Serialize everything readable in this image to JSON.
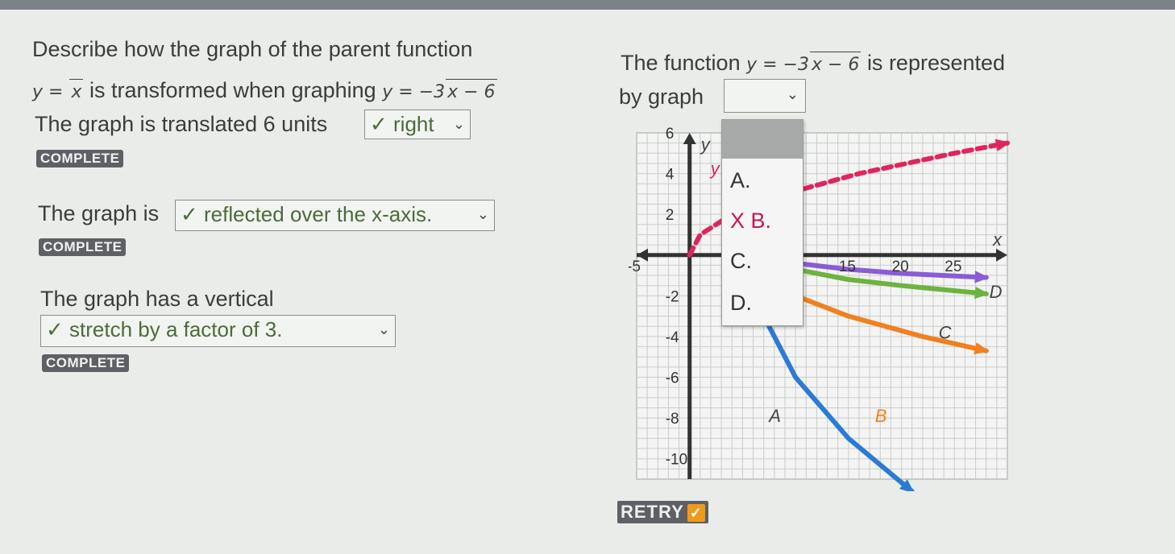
{
  "question": {
    "intro": "Describe how the graph of the parent function",
    "parent_fn": "y = √x",
    "parent_prefix": "y = ",
    "parent_radicand": "x",
    "transform_text": "is transformed when graphing",
    "target_prefix": "y = −3",
    "target_radicand": "x − 6",
    "target_fn": "y = −3√(x − 6)"
  },
  "part1": {
    "text": "The graph is translated 6 units",
    "answer": "✓ right",
    "status": "COMPLETE"
  },
  "part2": {
    "text": "The graph is",
    "answer": "✓ reflected over the x-axis.",
    "status": "COMPLETE"
  },
  "part3": {
    "text": "The graph has a vertical",
    "answer": "✓ stretch by a factor of 3.",
    "status": "COMPLETE"
  },
  "right_question": {
    "line1_prefix": "The function",
    "fn_prefix": "y = −3",
    "fn_radicand": "x − 6",
    "line1_suffix": "is represented",
    "line2": "by graph"
  },
  "dropdown": {
    "options": [
      "A.",
      "X B.",
      "C.",
      "D."
    ],
    "incorrect_option_color": "#c2185b"
  },
  "graph": {
    "x_axis_label": "x",
    "y_axis_label": "y",
    "x_ticks": [
      "-5",
      "15",
      "20",
      "25"
    ],
    "y_ticks": [
      "6",
      "4",
      "2",
      "-2",
      "-4",
      "-6",
      "-8",
      "-10"
    ],
    "curve_labels": {
      "A": "A",
      "B": "B",
      "C": "C",
      "D": "D",
      "y": "y"
    },
    "colors": {
      "y": "#e0245e",
      "A": "#2b7bd6",
      "B": "#f08020",
      "C": "#6db33f",
      "D": "#8a5cd6"
    }
  },
  "retry": {
    "label": "RETRY",
    "check": "✓"
  },
  "chart_data": {
    "type": "line",
    "title": "",
    "xlabel": "x",
    "ylabel": "y",
    "xlim": [
      -5,
      30
    ],
    "ylim": [
      -10,
      6
    ],
    "series": [
      {
        "name": "y",
        "style": "dashed",
        "x": [
          0,
          1,
          4,
          9,
          16,
          25,
          30
        ],
        "y": [
          0,
          1,
          2,
          3,
          4,
          5,
          5.5
        ]
      },
      {
        "name": "A",
        "x": [
          6,
          7,
          10,
          15,
          21
        ],
        "y": [
          0,
          -3,
          -6,
          -9,
          -11.6
        ]
      },
      {
        "name": "B",
        "x": [
          6,
          7,
          10,
          15,
          22,
          28
        ],
        "y": [
          0,
          -1,
          -2,
          -3,
          -4,
          -4.7
        ]
      },
      {
        "name": "C",
        "x": [
          6,
          10,
          15,
          20,
          28
        ],
        "y": [
          0,
          -0.7,
          -1.2,
          -1.5,
          -1.9
        ]
      },
      {
        "name": "D",
        "x": [
          6,
          10,
          15,
          20,
          28
        ],
        "y": [
          0,
          -0.4,
          -0.7,
          -0.9,
          -1.1
        ]
      }
    ]
  }
}
